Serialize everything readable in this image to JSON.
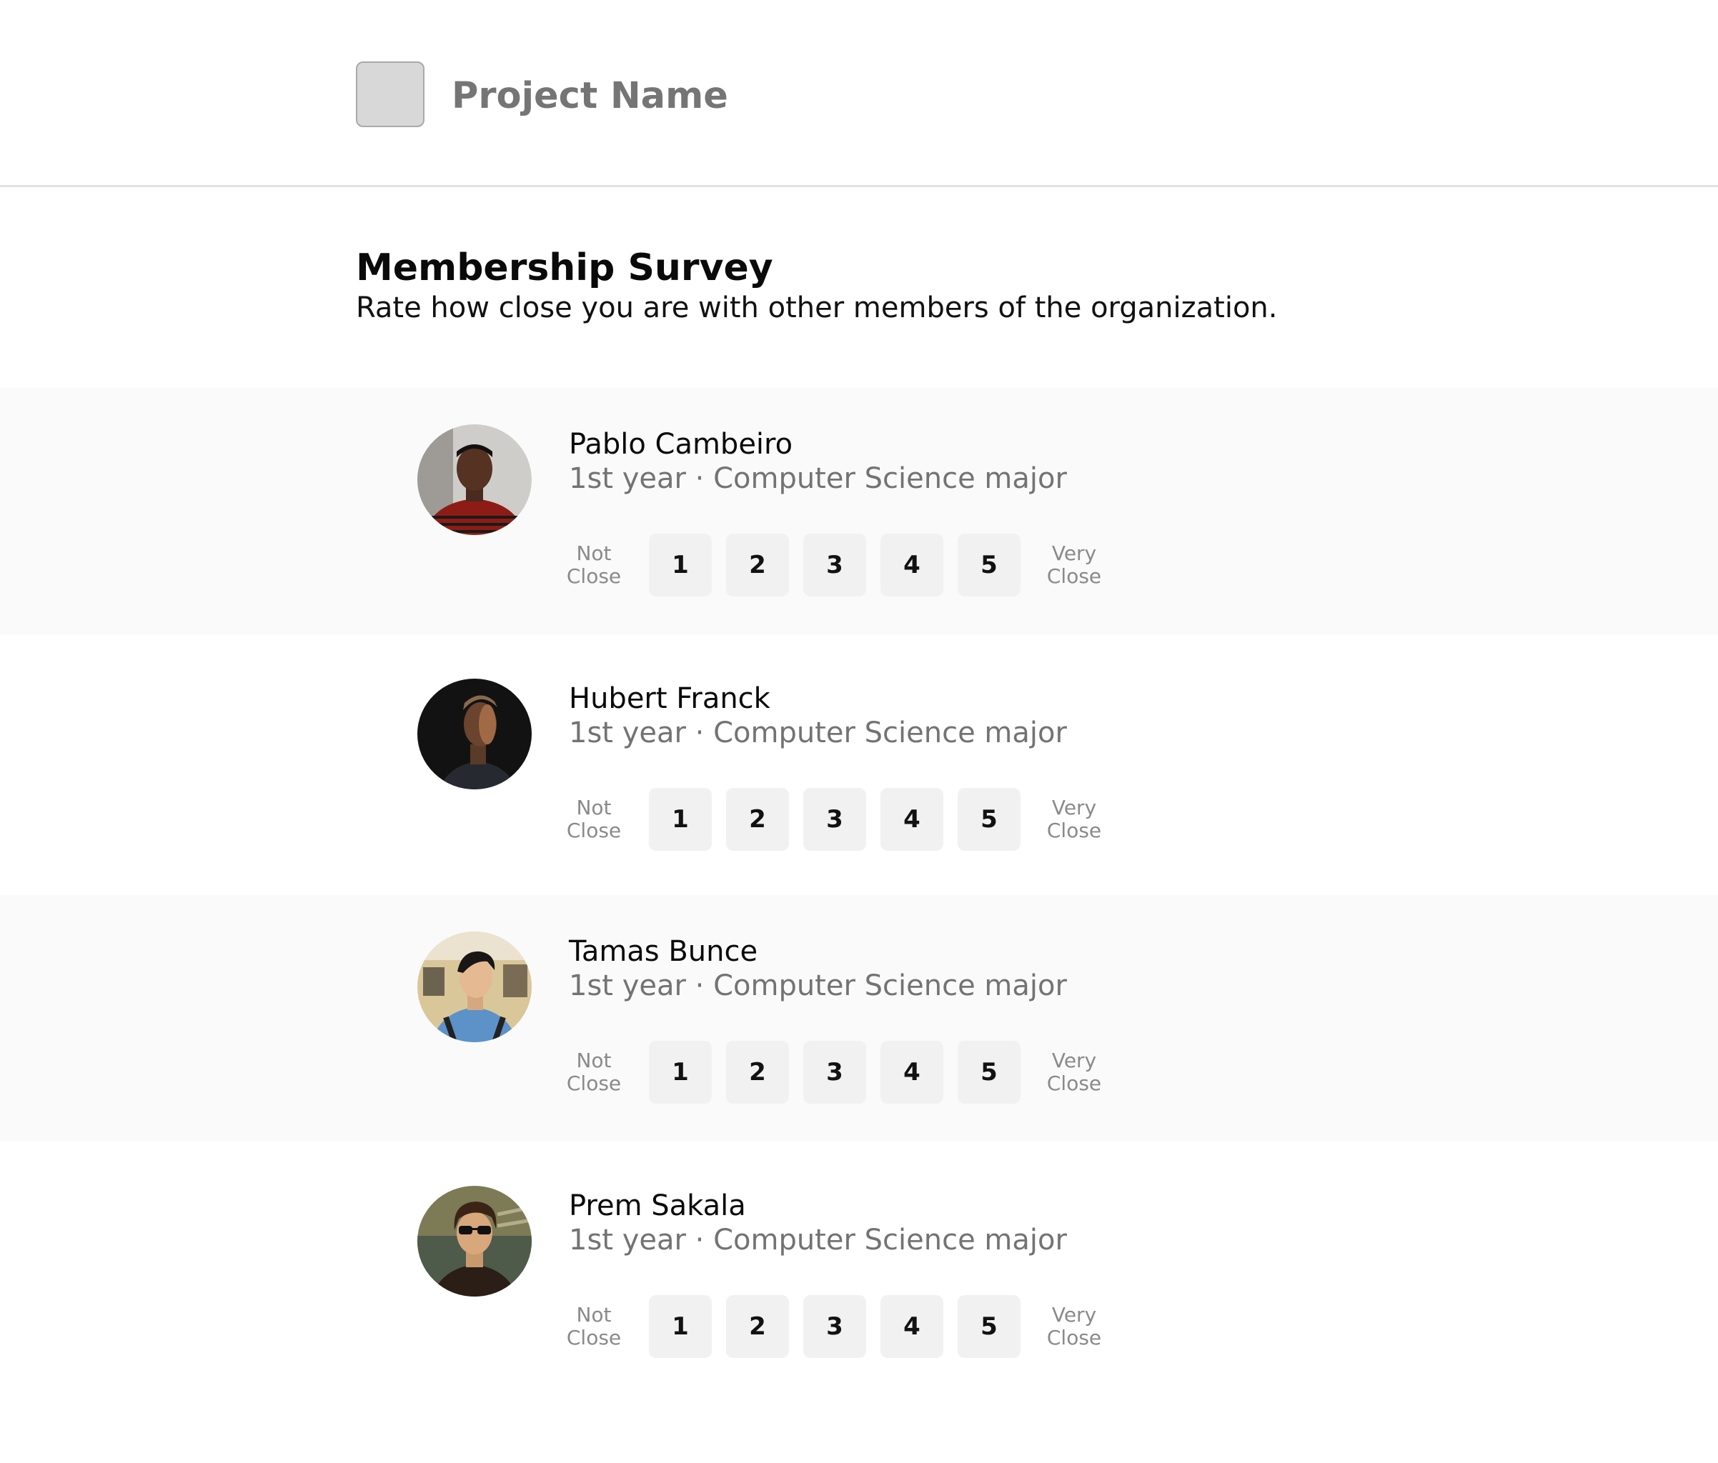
{
  "header": {
    "project_name": "Project Name"
  },
  "survey": {
    "title": "Membership Survey",
    "subtitle": "Rate how close you are with other members of the organization.",
    "scale_low_line1": "Not",
    "scale_low_line2": "Close",
    "scale_high_line1": "Very",
    "scale_high_line2": "Close",
    "ratings": [
      "1",
      "2",
      "3",
      "4",
      "5"
    ]
  },
  "members": [
    {
      "name": "Pablo Cambeiro",
      "details": "1st year · Computer Science major"
    },
    {
      "name": "Hubert Franck",
      "details": "1st year · Computer Science major"
    },
    {
      "name": "Tamas Bunce",
      "details": "1st year · Computer Science major"
    },
    {
      "name": "Prem Sakala",
      "details": "1st year · Computer Science major"
    }
  ],
  "colors": {
    "row_shade": "#fafafa",
    "button_bg": "#f1f1f1",
    "muted_text": "#737373"
  }
}
